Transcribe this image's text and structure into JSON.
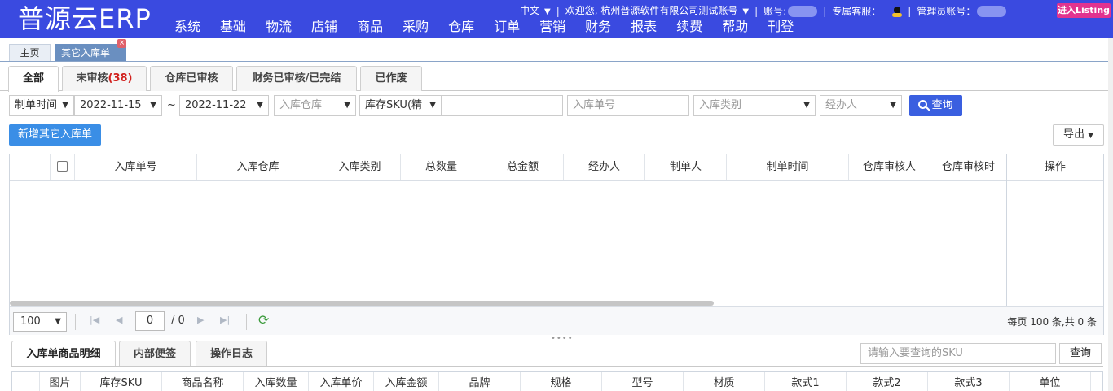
{
  "header": {
    "logo": "普源云ERP",
    "nav": [
      "系统",
      "基础",
      "物流",
      "店铺",
      "商品",
      "采购",
      "仓库",
      "订单",
      "营销",
      "财务",
      "报表",
      "续费",
      "帮助",
      "刊登"
    ],
    "language": "中文",
    "welcome": "欢迎您, 杭州普源软件有限公司测试账号",
    "account_label": "账号:",
    "service_label": "专属客服：",
    "admin_label": "管理员账号：",
    "listing_button": "进入Listing",
    "colors": {
      "header_bg": "#3a4ae0",
      "listing_bg": "#e2338f"
    }
  },
  "page_tabs": {
    "home": "主页",
    "active": "其它入库单",
    "close_glyph": "×"
  },
  "status_tabs": {
    "all": "全部",
    "unreviewed": "未审核",
    "unreviewed_count": "(38)",
    "warehouse_reviewed": "仓库已审核",
    "finance_done": "财务已审核/已完结",
    "voided": "已作废"
  },
  "filters": {
    "date_type": "制单时间",
    "date_from": "2022-11-15",
    "tilde": "~",
    "date_to": "2022-11-22",
    "warehouse_placeholder": "入库仓库",
    "sku_mode": "库存SKU(精",
    "sku_value": "",
    "order_no_placeholder": "入库单号",
    "type_placeholder": "入库类别",
    "handler_placeholder": "经办人",
    "query_button": "查询"
  },
  "actions": {
    "new_button": "新增其它入库单",
    "export_button": "导出"
  },
  "grid": {
    "columns": [
      "入库单号",
      "入库仓库",
      "入库类别",
      "总数量",
      "总金额",
      "经办人",
      "制单人",
      "制单时间",
      "仓库审核人",
      "仓库审核时"
    ],
    "op_column": "操作",
    "rows": []
  },
  "pager": {
    "page_size": "100",
    "page": "0",
    "total_pages": "/ 0",
    "info": "每页 100 条,共 0 条"
  },
  "bottom_tabs": {
    "items": [
      "入库单商品明细",
      "内部便签",
      "操作日志"
    ],
    "sku_placeholder": "请输入要查询的SKU",
    "query_button": "查询"
  },
  "detail_grid": {
    "columns": [
      "图片",
      "库存SKU",
      "商品名称",
      "入库数量",
      "入库单价",
      "入库金额",
      "品牌",
      "规格",
      "型号",
      "材质",
      "款式1",
      "款式2",
      "款式3",
      "单位"
    ]
  }
}
